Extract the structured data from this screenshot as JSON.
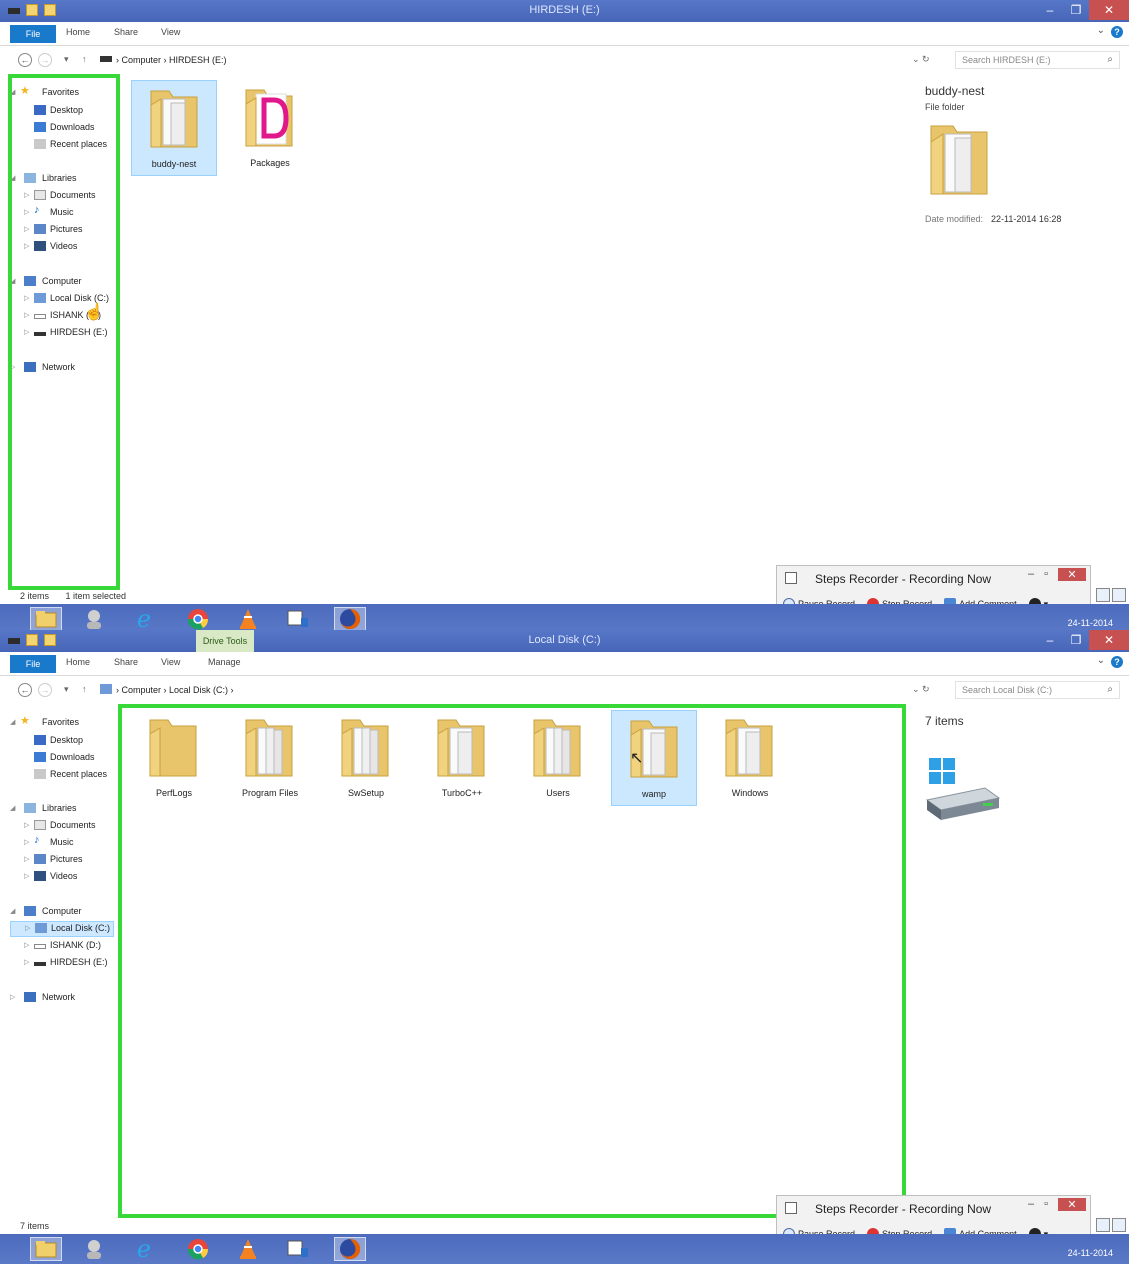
{
  "screen1": {
    "window_title": "HIRDESH (E:)",
    "ribbon": {
      "file": "File",
      "home": "Home",
      "share": "Share",
      "view": "View"
    },
    "breadcrumb": "›  Computer  ›  HIRDESH (E:)",
    "search_placeholder": "Search HIRDESH (E:)",
    "nav": {
      "favorites": "Favorites",
      "desktop": "Desktop",
      "downloads": "Downloads",
      "recent": "Recent places",
      "libraries": "Libraries",
      "documents": "Documents",
      "music": "Music",
      "pictures": "Pictures",
      "videos": "Videos",
      "computer": "Computer",
      "local_disk": "Local Disk (C:)",
      "ishank": "ISHANK (D:)",
      "hirdesh": "HIRDESH (E:)",
      "network": "Network"
    },
    "items": [
      {
        "label": "buddy-nest"
      },
      {
        "label": "Packages"
      }
    ],
    "details": {
      "name": "buddy-nest",
      "type": "File folder",
      "modified_label": "Date modified:",
      "modified_value": "22-11-2014 16:28"
    },
    "status": {
      "count": "2 items",
      "selected": "1 item selected"
    }
  },
  "screen2": {
    "window_title": "Local Disk (C:)",
    "context_tab": "Drive Tools",
    "ribbon": {
      "file": "File",
      "home": "Home",
      "share": "Share",
      "view": "View",
      "manage": "Manage"
    },
    "breadcrumb": "›  Computer  ›  Local Disk (C:)  ›",
    "search_placeholder": "Search Local Disk (C:)",
    "nav": {
      "favorites": "Favorites",
      "desktop": "Desktop",
      "downloads": "Downloads",
      "recent": "Recent places",
      "libraries": "Libraries",
      "documents": "Documents",
      "music": "Music",
      "pictures": "Pictures",
      "videos": "Videos",
      "computer": "Computer",
      "local_disk": "Local Disk (C:)",
      "ishank": "ISHANK (D:)",
      "hirdesh": "HIRDESH (E:)",
      "network": "Network"
    },
    "items": [
      {
        "label": "PerfLogs"
      },
      {
        "label": "Program Files"
      },
      {
        "label": "SwSetup"
      },
      {
        "label": "TurboC++"
      },
      {
        "label": "Users"
      },
      {
        "label": "wamp"
      },
      {
        "label": "Windows"
      }
    ],
    "details": {
      "count": "7 items"
    },
    "status": {
      "count": "7 items"
    }
  },
  "steps_recorder": {
    "title": "Steps Recorder - Recording Now",
    "pause": "Pause Record",
    "stop": "Stop Record",
    "comment": "Add Comment"
  },
  "tray_date": "24-11-2014",
  "colors": {
    "highlight": "#39d839",
    "titlebar": "#4766b8",
    "selection": "#cce8ff"
  }
}
